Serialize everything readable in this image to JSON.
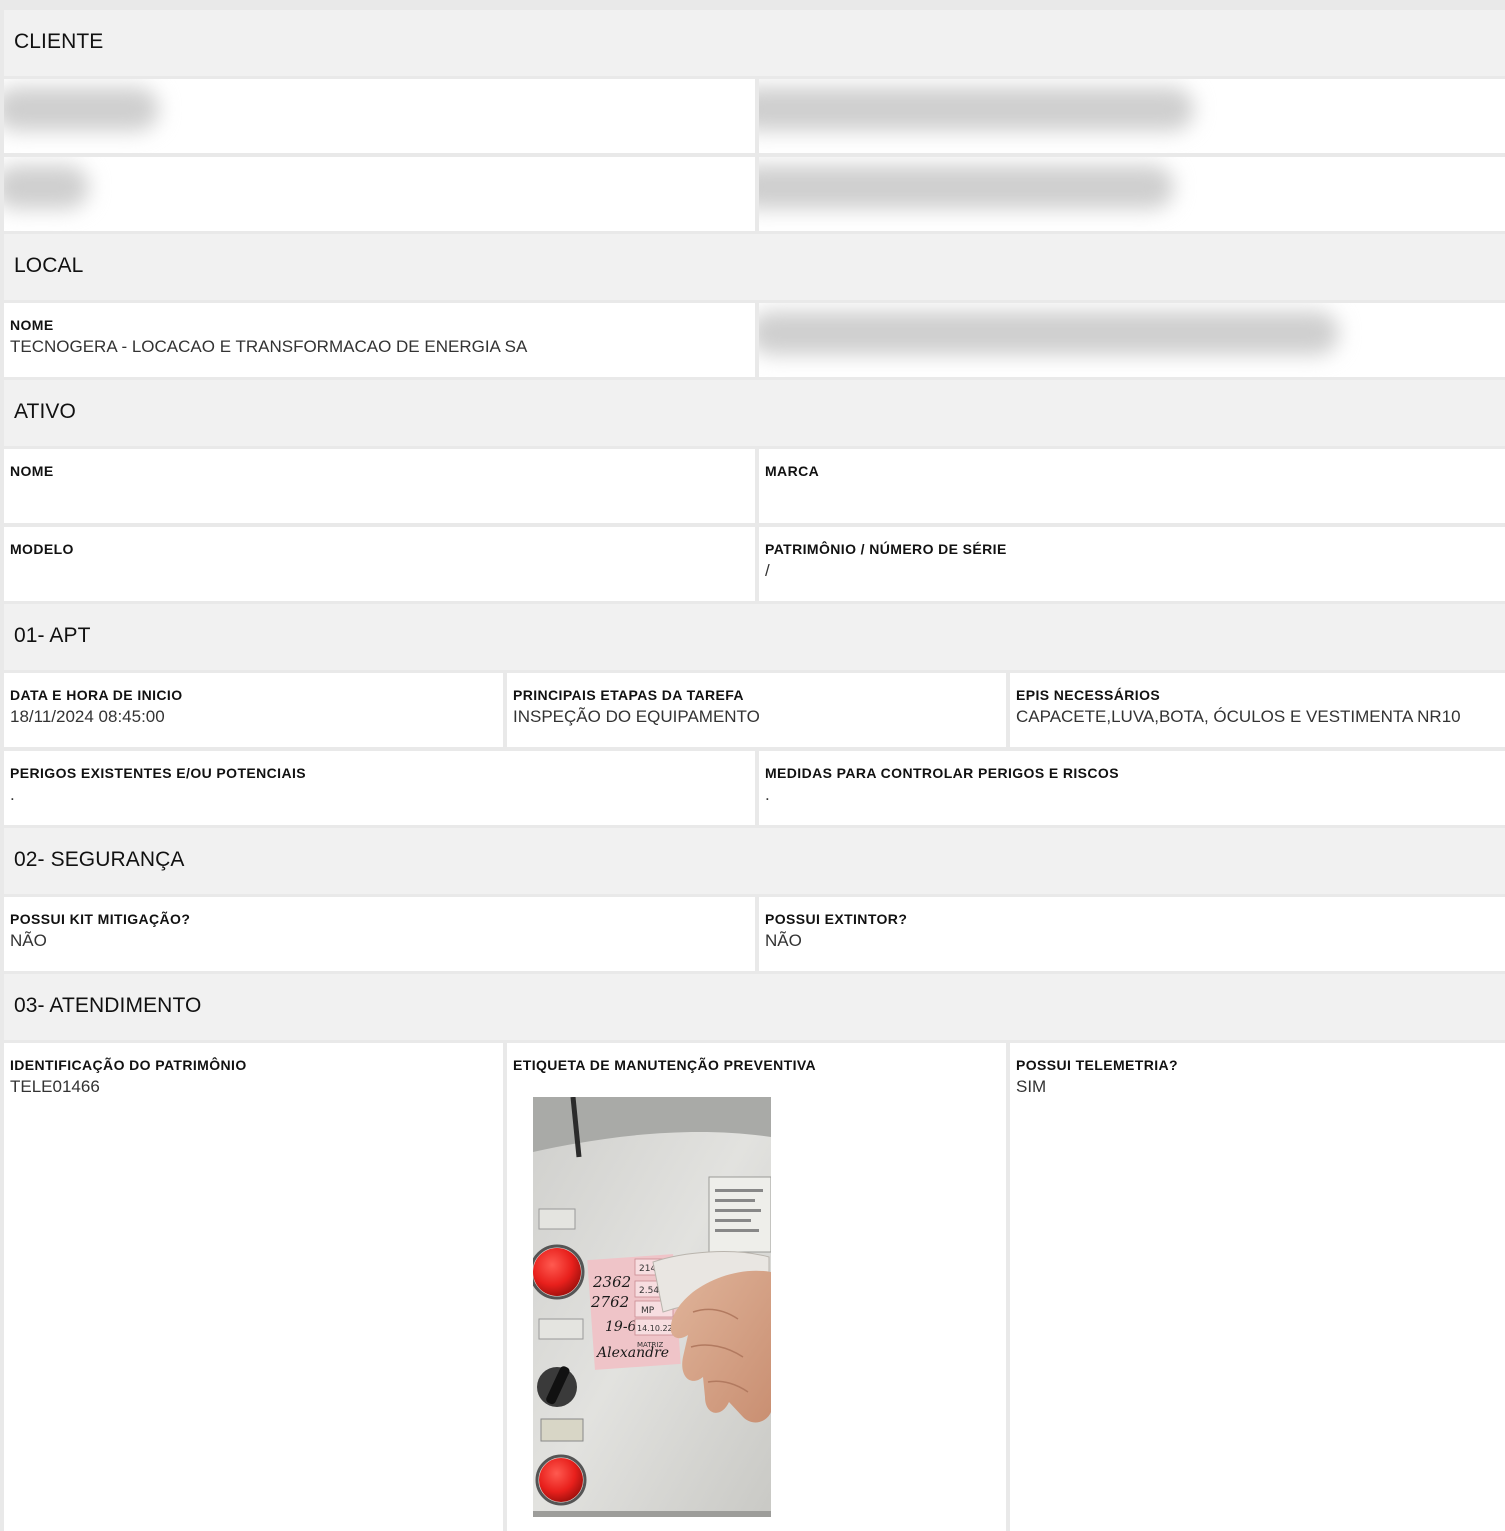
{
  "sections": {
    "cliente": "CLIENTE",
    "local": "LOCAL",
    "ativo": "ATIVO",
    "apt": "01- APT",
    "seguranca": "02- SEGURANÇA",
    "atendimento": "03- ATENDIMENTO"
  },
  "local": {
    "nome_label": "NOME",
    "nome_value": "TECNOGERA - LOCACAO E TRANSFORMACAO DE ENERGIA SA"
  },
  "ativo": {
    "nome_label": "NOME",
    "marca_label": "MARCA",
    "modelo_label": "MODELO",
    "patrimonio_label": "PATRIMÔNIO / NÚMERO DE SÉRIE",
    "patrimonio_value": "/"
  },
  "apt": {
    "data_label": "DATA E HORA DE INICIO",
    "data_value": "18/11/2024 08:45:00",
    "etapas_label": "PRINCIPAIS ETAPAS DA TAREFA",
    "etapas_value": "INSPEÇÃO DO EQUIPAMENTO",
    "epis_label": "EPIS NECESSÁRIOS",
    "epis_value": "CAPACETE,LUVA,BOTA, ÓCULOS E VESTIMENTA NR10",
    "perigos_label": "PERIGOS EXISTENTES E/OU POTENCIAIS",
    "perigos_value": ".",
    "medidas_label": "MEDIDAS PARA CONTROLAR PERIGOS E RISCOS",
    "medidas_value": "."
  },
  "seguranca": {
    "kit_label": "POSSUI KIT MITIGAÇÃO?",
    "kit_value": "NÃO",
    "extintor_label": "POSSUI EXTINTOR?",
    "extintor_value": "NÃO"
  },
  "atendimento": {
    "identificacao_label": "IDENTIFICAÇÃO DO PATRIMÔNIO",
    "identificacao_value": "TELE01466",
    "etiqueta_label": "ETIQUETA DE MANUTENÇÃO PREVENTIVA",
    "telemetria_label": "POSSUI TELEMETRIA?",
    "telemetria_value": "SIM"
  },
  "photo": {
    "tag_lines": [
      "2362",
      "2762",
      "19-6",
      "Alexandre"
    ],
    "tag_cells": [
      "2145",
      "2.545",
      "MP",
      "14.10.22",
      "MATRIZ"
    ]
  },
  "colors": {
    "page_bg": "#e9e9e9",
    "section_bg": "#f1f1f1",
    "cell_bg": "#ffffff",
    "panel_gray": "#d9d9d6",
    "button_red": "#e8201c",
    "tag_pink": "#efc4c8"
  }
}
